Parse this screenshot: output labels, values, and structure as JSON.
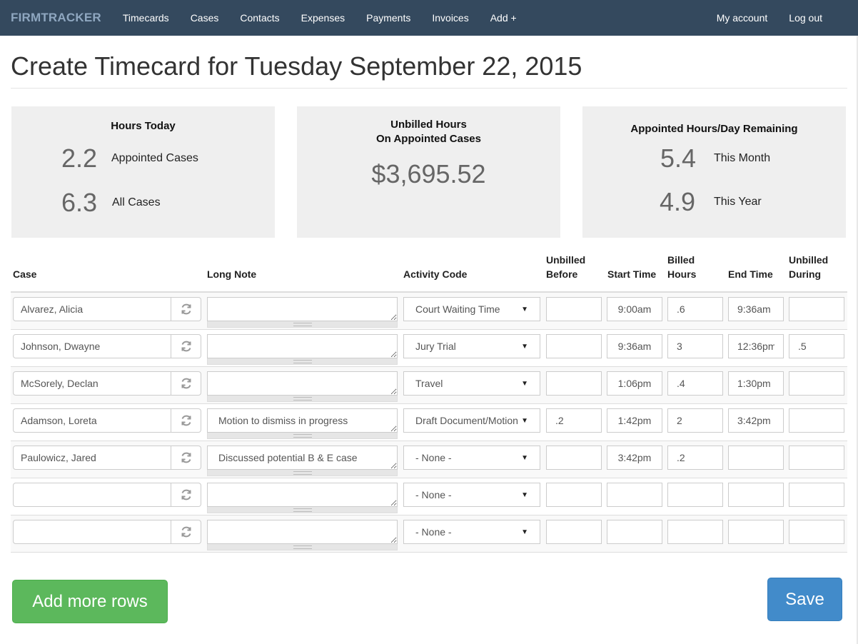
{
  "nav": {
    "brand": "FIRMTRACKER",
    "links": [
      "Timecards",
      "Cases",
      "Contacts",
      "Expenses",
      "Payments",
      "Invoices",
      "Add +"
    ],
    "right_links": [
      "My account",
      "Log out"
    ]
  },
  "page_title": "Create Timecard for Tuesday September 22, 2015",
  "stats": {
    "hours_today": {
      "title": "Hours Today",
      "rows": [
        {
          "value": "2.2",
          "label": "Appointed Cases"
        },
        {
          "value": "6.3",
          "label": "All Cases"
        }
      ]
    },
    "unbilled": {
      "title_line1": "Unbilled Hours",
      "title_line2": "On Appointed Cases",
      "value": "$3,695.52"
    },
    "remaining": {
      "title": "Appointed Hours/Day Remaining",
      "rows": [
        {
          "value": "5.4",
          "label": "This Month"
        },
        {
          "value": "4.9",
          "label": "This Year"
        }
      ]
    }
  },
  "table": {
    "headers": {
      "case": "Case",
      "long_note": "Long Note",
      "activity_code": "Activity Code",
      "unbilled_before_1": "Unbilled",
      "unbilled_before_2": "Before",
      "start_time": "Start Time",
      "billed_hours_1": "Billed",
      "billed_hours_2": "Hours",
      "end_time": "End Time",
      "unbilled_during_1": "Unbilled",
      "unbilled_during_2": "During"
    },
    "rows": [
      {
        "case": "Alvarez, Alicia",
        "note": "",
        "activity": "Court Waiting Time",
        "unbilled_before": "",
        "start": "9:00am",
        "billed": ".6",
        "end": "9:36am",
        "unbilled_during": ""
      },
      {
        "case": "Johnson, Dwayne",
        "note": "",
        "activity": "Jury Trial",
        "unbilled_before": "",
        "start": "9:36am",
        "billed": "3",
        "end": "12:36pm",
        "unbilled_during": ".5"
      },
      {
        "case": "McSorely, Declan",
        "note": "",
        "activity": "Travel",
        "unbilled_before": "",
        "start": "1:06pm",
        "billed": ".4",
        "end": "1:30pm",
        "unbilled_during": ""
      },
      {
        "case": "Adamson, Loreta",
        "note": "Motion to dismiss in progress",
        "activity": "Draft Document/Motion",
        "unbilled_before": ".2",
        "start": "1:42pm",
        "billed": "2",
        "end": "3:42pm",
        "unbilled_during": ""
      },
      {
        "case": "Paulowicz, Jared",
        "note": "Discussed potential B & E case",
        "activity": "- None -",
        "unbilled_before": "",
        "start": "3:42pm",
        "billed": ".2",
        "end": "",
        "unbilled_during": ""
      },
      {
        "case": "",
        "note": "",
        "activity": "- None -",
        "unbilled_before": "",
        "start": "",
        "billed": "",
        "end": "",
        "unbilled_during": ""
      },
      {
        "case": "",
        "note": "",
        "activity": "- None -",
        "unbilled_before": "",
        "start": "",
        "billed": "",
        "end": "",
        "unbilled_during": ""
      }
    ]
  },
  "buttons": {
    "add_rows": "Add more rows",
    "save": "Save"
  },
  "colors": {
    "navbar": "#34495e",
    "brand": "#8fa7c0",
    "add_button": "#5cb85c",
    "save_button": "#428bca",
    "stat_box": "#efefef"
  }
}
